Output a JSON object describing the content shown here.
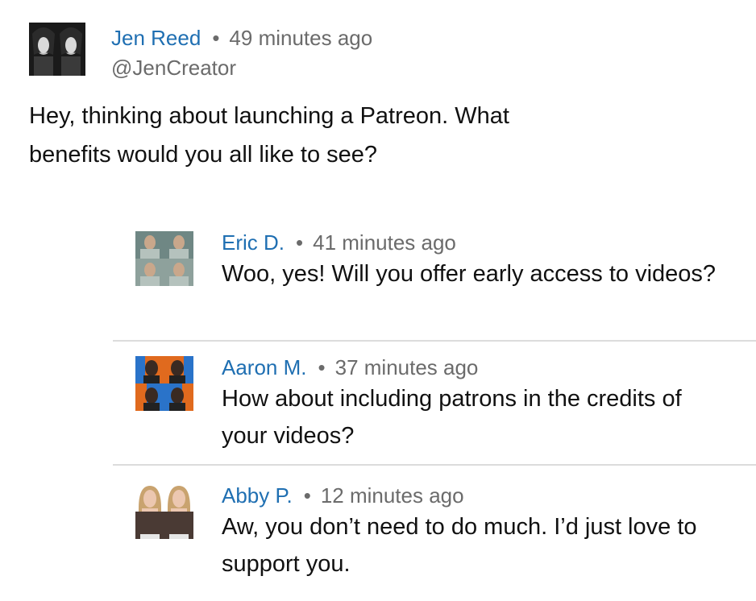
{
  "post": {
    "author": "Jen Reed",
    "separator": "•",
    "time": "49 minutes ago",
    "handle": "@JenCreator",
    "body": "Hey, thinking about launching a Patreon. What benefits would you all like to see?"
  },
  "replies": [
    {
      "author": "Eric D.",
      "separator": "•",
      "time": "41 minutes ago",
      "text": "Woo, yes! Will you offer early access to videos?",
      "avatar_icon": "eric-avatar"
    },
    {
      "author": "Aaron M.",
      "separator": "•",
      "time": "37 minutes ago",
      "text": "How about including patrons in the credits of your videos?",
      "avatar_icon": "aaron-avatar"
    },
    {
      "author": "Abby P.",
      "separator": "•",
      "time": "12 minutes ago",
      "text": "Aw, you don’t need to do much. I’d just love to support you.",
      "avatar_icon": "abby-avatar"
    }
  ],
  "colors": {
    "author_link": "#1f6fb2",
    "meta_gray": "#6b6b6b",
    "body_text": "#111111",
    "divider": "#dcdcdc"
  }
}
